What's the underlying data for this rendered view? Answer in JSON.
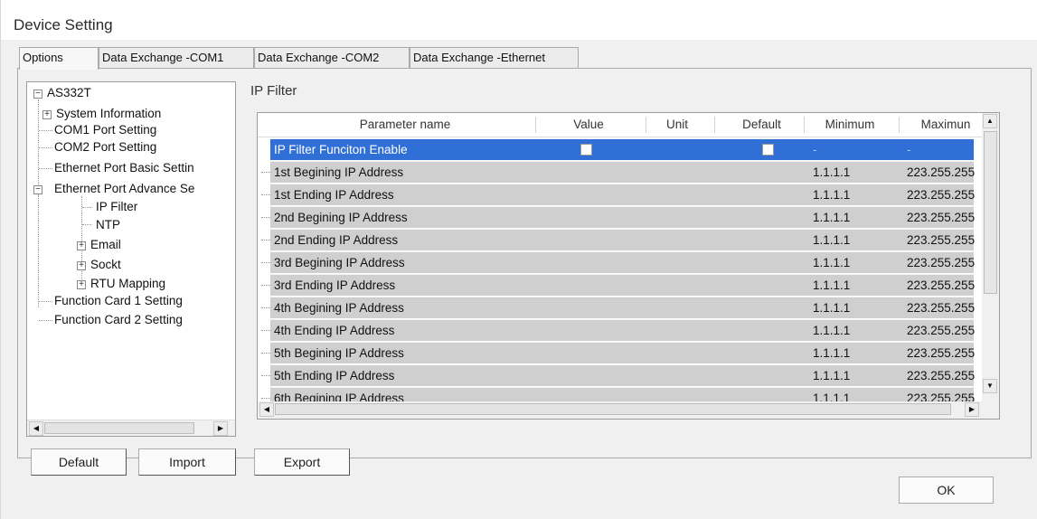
{
  "window": {
    "title": "Device Setting"
  },
  "tabs": [
    {
      "label": "Options",
      "active": true
    },
    {
      "label": "Data Exchange -COM1",
      "active": false
    },
    {
      "label": "Data Exchange -COM2",
      "active": false
    },
    {
      "label": "Data Exchange -Ethernet",
      "active": false
    }
  ],
  "tree": {
    "root": "AS332T",
    "items": {
      "system_info": "System Information",
      "com1": "COM1 Port Setting",
      "com2": "COM2 Port Setting",
      "eth_basic": "Ethernet Port Basic Settin",
      "eth_adv": "Ethernet Port Advance Se",
      "ip_filter": "IP Filter",
      "ntp": "NTP",
      "email": "Email",
      "sockt": "Sockt",
      "rtu": "RTU Mapping",
      "fc1": "Function Card 1 Setting",
      "fc2": "Function Card 2 Setting"
    }
  },
  "section": {
    "title": "IP Filter"
  },
  "grid": {
    "columns": [
      "Parameter name",
      "Value",
      "Unit",
      "Default",
      "Minimum",
      "Maximun"
    ],
    "rows": [
      {
        "name": "IP Filter Funciton Enable",
        "value_checkbox": true,
        "default_checkbox": true,
        "min": "-",
        "max": "-",
        "selected": true
      },
      {
        "name": "1st Begining IP Address",
        "min": "1.1.1.1",
        "max": "223.255.255"
      },
      {
        "name": "1st Ending IP Address",
        "min": "1.1.1.1",
        "max": "223.255.255"
      },
      {
        "name": "2nd Begining IP Address",
        "min": "1.1.1.1",
        "max": "223.255.255"
      },
      {
        "name": "2nd Ending IP Address",
        "min": "1.1.1.1",
        "max": "223.255.255"
      },
      {
        "name": "3rd Begining IP Address",
        "min": "1.1.1.1",
        "max": "223.255.255"
      },
      {
        "name": "3rd Ending IP Address",
        "min": "1.1.1.1",
        "max": "223.255.255"
      },
      {
        "name": "4th Begining IP Address",
        "min": "1.1.1.1",
        "max": "223.255.255"
      },
      {
        "name": "4th Ending IP Address",
        "min": "1.1.1.1",
        "max": "223.255.255"
      },
      {
        "name": "5th Begining IP Address",
        "min": "1.1.1.1",
        "max": "223.255.255"
      },
      {
        "name": "5th Ending IP Address",
        "min": "1.1.1.1",
        "max": "223.255.255"
      },
      {
        "name": "6th Begining IP Address",
        "min": "1.1.1.1",
        "max": "223.255.255"
      }
    ]
  },
  "buttons": {
    "default": "Default",
    "import": "Import",
    "export": "Export",
    "ok": "OK"
  },
  "colors": {
    "selection": "#2f6fd6",
    "row_bg": "#cfcfcf"
  }
}
